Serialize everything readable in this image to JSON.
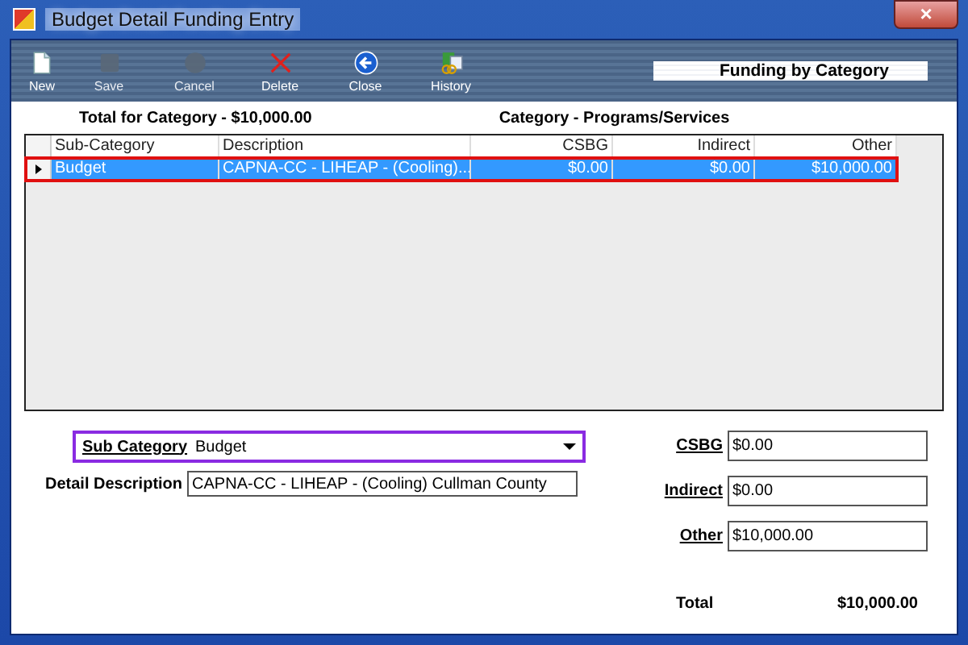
{
  "window": {
    "title": "Budget Detail Funding Entry",
    "close": "×"
  },
  "toolbar": {
    "buttons": [
      {
        "label": "New",
        "kind": "new",
        "disabled": false
      },
      {
        "label": "Save",
        "kind": "save",
        "disabled": true
      },
      {
        "label": "Cancel",
        "kind": "cancel",
        "disabled": true
      },
      {
        "label": "Delete",
        "kind": "delete",
        "disabled": false
      },
      {
        "label": "Close",
        "kind": "close",
        "disabled": false
      },
      {
        "label": "History",
        "kind": "history",
        "disabled": false
      }
    ],
    "panel_title": "Funding by Category"
  },
  "total_for_category": "Total for Category - $10,000.00",
  "category": "Category - Programs/Services",
  "table": {
    "columns": [
      "Sub-Category",
      "Description",
      "CSBG",
      "Indirect",
      "Other"
    ],
    "rows": [
      {
        "selected": true,
        "cells": [
          "Budget",
          "CAPNA-CC - LIHEAP - (Cooling)...",
          "$0.00",
          "$0.00",
          "$10,000.00"
        ]
      }
    ]
  },
  "form": {
    "sub_category": {
      "label": "Sub Category",
      "value": "Budget",
      "highlighted": true
    },
    "detail_description": {
      "label": "Detail Description",
      "value": "CAPNA-CC - LIHEAP - (Cooling) Cullman County"
    },
    "amounts": [
      {
        "label": "CSBG",
        "value": "$0.00"
      },
      {
        "label": "Indirect",
        "value": "$0.00"
      },
      {
        "label": "Other",
        "value": "$10,000.00"
      }
    ],
    "total": {
      "label": "Total",
      "value": "$10,000.00"
    }
  }
}
